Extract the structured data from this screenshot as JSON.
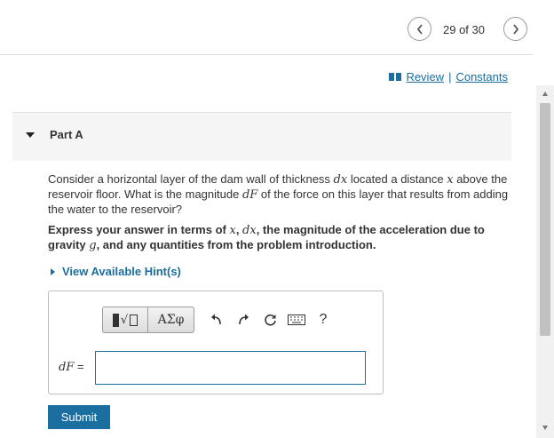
{
  "nav": {
    "prev_icon": "chevron-left-icon",
    "next_icon": "chevron-right-icon",
    "pager_text": "29 of 30"
  },
  "links": {
    "review": "Review",
    "separator": "|",
    "constants": "Constants"
  },
  "part": {
    "title": "Part A"
  },
  "question": {
    "t1": "Consider a horizontal layer of the dam wall of thickness ",
    "m1": "dx",
    "t2": " located a distance ",
    "m2": "x",
    "t3": " above the reservoir floor. What is the magnitude ",
    "m3": "dF",
    "t4": " of the force on this layer that results from adding the water to the reservoir?"
  },
  "instruction": {
    "t1": "Express your answer in terms of ",
    "m1": "x",
    "t2": ", ",
    "m2": "dx",
    "t3": ", the magnitude of the acceleration due to gravity ",
    "m3": "g",
    "t4": ", and any quantities from the problem introduction."
  },
  "hints": {
    "label": "View Available Hint(s)"
  },
  "toolbar": {
    "templates_sqrt": "√",
    "greek_label": "ΑΣφ",
    "help_label": "?"
  },
  "answer": {
    "variable": "dF",
    "equals": " =",
    "value": ""
  },
  "submit": {
    "label": "Submit"
  },
  "colors": {
    "accent": "#1a6ea0",
    "header_bg": "#f5f5f5"
  }
}
